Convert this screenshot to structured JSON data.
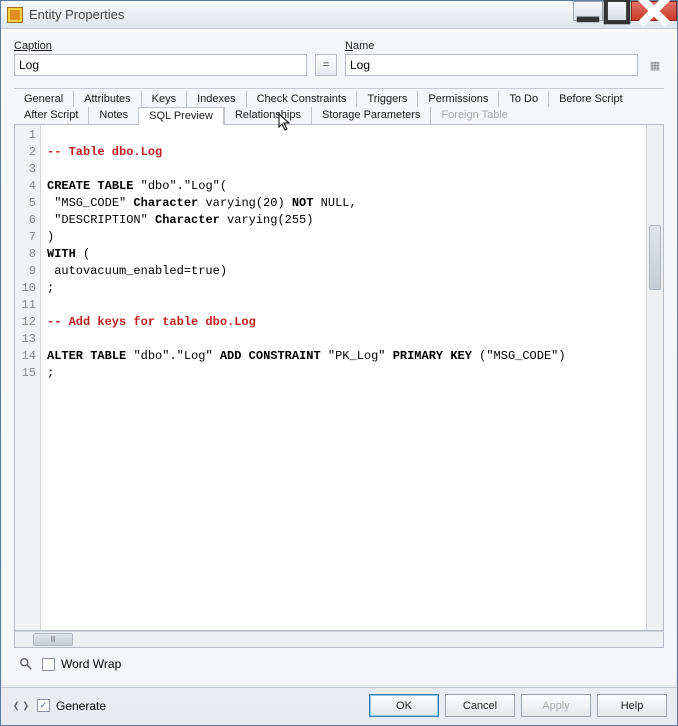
{
  "window": {
    "title": "Entity Properties"
  },
  "form": {
    "caption_label": "Caption",
    "caption_value": "Log",
    "name_label": "Name",
    "name_value": "Log",
    "eq_label": "="
  },
  "tabs_row1": [
    "General",
    "Attributes",
    "Keys",
    "Indexes",
    "Check Constraints",
    "Triggers",
    "Permissions",
    "To Do",
    "Before Script"
  ],
  "tabs_row2": [
    "After Script",
    "Notes",
    "SQL Preview",
    "Relationships",
    "Storage Parameters",
    "Foreign Table"
  ],
  "active_tab": "SQL Preview",
  "disabled_tab": "Foreign Table",
  "sql_lines": [
    "",
    "-- Table dbo.Log",
    "",
    "CREATE TABLE \"dbo\".\"Log\"(",
    " \"MSG_CODE\" Character varying(20) NOT NULL,",
    " \"DESCRIPTION\" Character varying(255)",
    ")",
    "WITH (",
    " autovacuum_enabled=true)",
    ";",
    "",
    "-- Add keys for table dbo.Log",
    "",
    "ALTER TABLE \"dbo\".\"Log\" ADD CONSTRAINT \"PK_Log\" PRIMARY KEY (\"MSG_CODE\")",
    ";"
  ],
  "wordwrap": {
    "label": "Word Wrap",
    "checked": false
  },
  "generate": {
    "label": "Generate",
    "checked": true
  },
  "buttons": {
    "ok": "OK",
    "cancel": "Cancel",
    "apply": "Apply",
    "help": "Help"
  }
}
